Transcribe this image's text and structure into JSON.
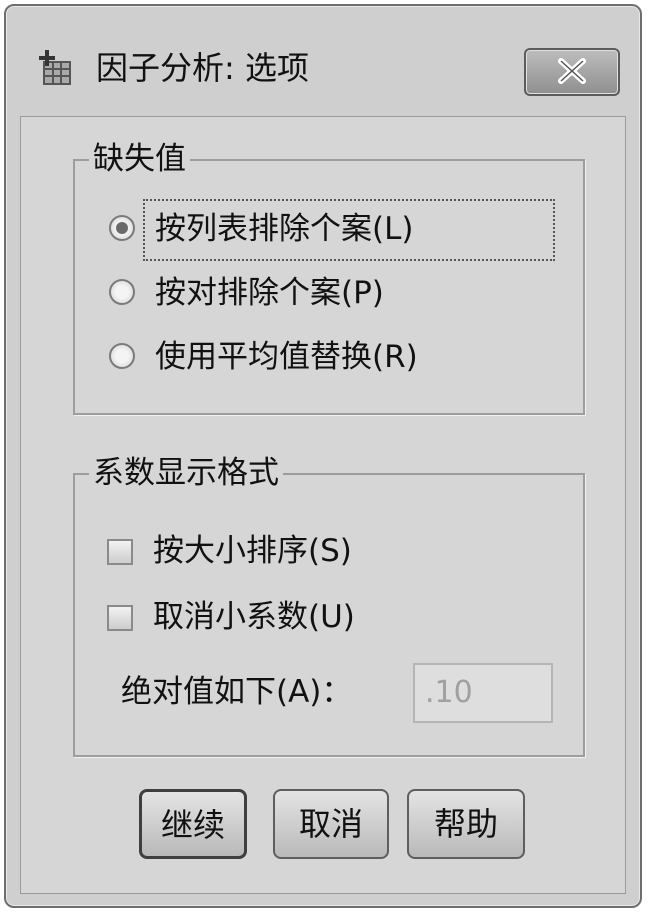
{
  "window": {
    "title": "因子分析: 选项",
    "close_label": "✕"
  },
  "missing_values": {
    "legend": "缺失值",
    "options": [
      {
        "label": "按列表排除个案(L)",
        "selected": true
      },
      {
        "label": "按对排除个案(P)",
        "selected": false
      },
      {
        "label": "使用平均值替换(R)",
        "selected": false
      }
    ]
  },
  "coefficient_format": {
    "legend": "系数显示格式",
    "sort_by_size": {
      "label": "按大小排序(S)",
      "checked": false
    },
    "suppress_small": {
      "label": "取消小系数(U)",
      "checked": false
    },
    "absolute_value_label": "绝对值如下(A)：",
    "absolute_value": ".10"
  },
  "buttons": {
    "continue": "继续",
    "cancel": "取消",
    "help": "帮助"
  }
}
